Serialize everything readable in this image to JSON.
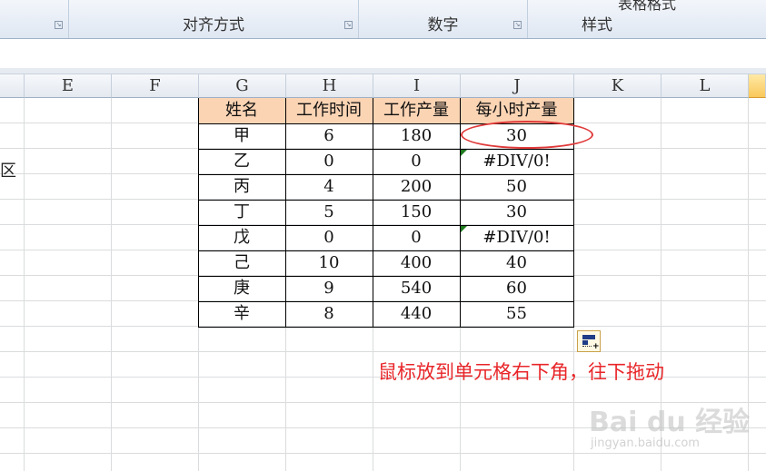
{
  "ribbon": {
    "groups": [
      {
        "label": ""
      },
      {
        "label": "对齐方式"
      },
      {
        "label": "数字"
      },
      {
        "label": "样式",
        "top_label": "表格格式"
      }
    ]
  },
  "sheet": {
    "columns": [
      "E",
      "F",
      "G",
      "H",
      "I",
      "J",
      "K",
      "L"
    ],
    "row_fragment": "区"
  },
  "table": {
    "headers": [
      "姓名",
      "工作时间",
      "工作产量",
      "每小时产量"
    ],
    "rows": [
      [
        "甲",
        "6",
        "180",
        "30"
      ],
      [
        "乙",
        "0",
        "0",
        "#DIV/0!"
      ],
      [
        "丙",
        "4",
        "200",
        "50"
      ],
      [
        "丁",
        "5",
        "150",
        "30"
      ],
      [
        "戊",
        "0",
        "0",
        "#DIV/0!"
      ],
      [
        "己",
        "10",
        "400",
        "40"
      ],
      [
        "庚",
        "9",
        "540",
        "60"
      ],
      [
        "辛",
        "8",
        "440",
        "55"
      ]
    ]
  },
  "annotation": "鼠标放到单元格右下角，往下拖动",
  "watermark": {
    "brand": "Bai du 经验",
    "url": "jingyan.baidu.com"
  },
  "colors": {
    "header_fill": "#fbd4b4",
    "annotation": "#e8262a",
    "selected_column": "#f9c85a"
  }
}
